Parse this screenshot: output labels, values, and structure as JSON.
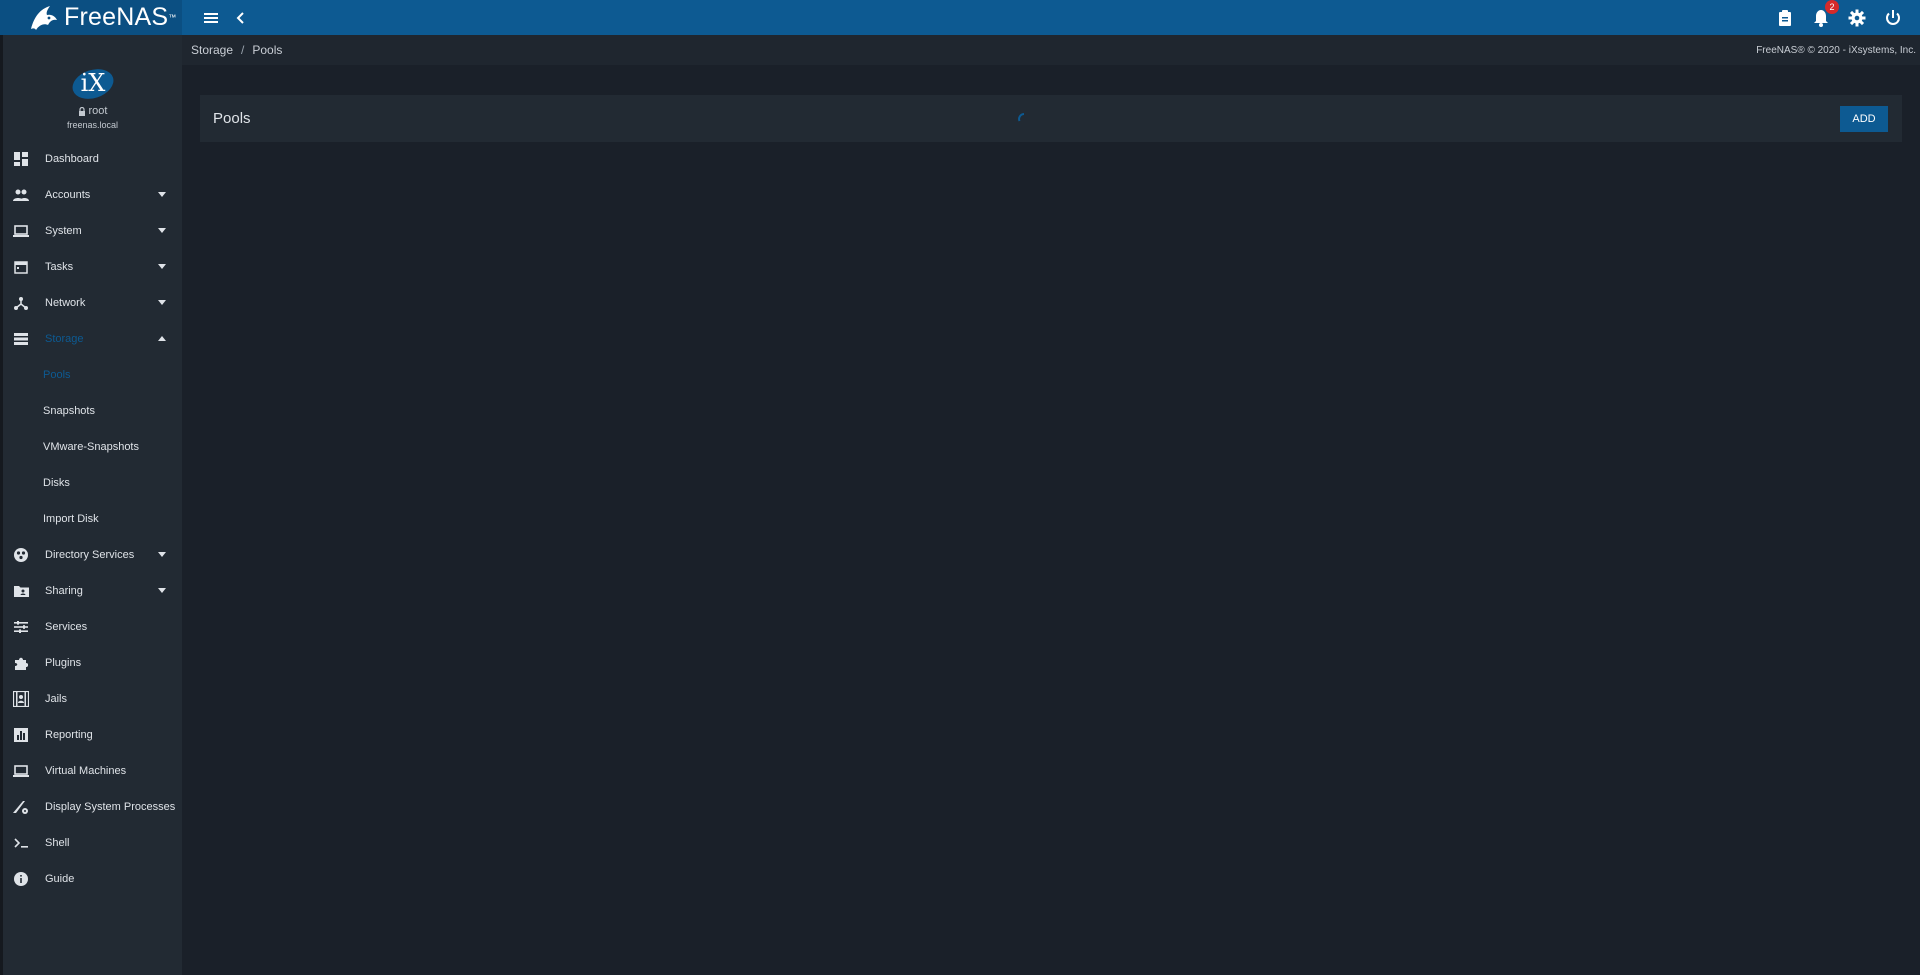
{
  "app": {
    "logo_text": "FreeNAS",
    "logo_tm": "™"
  },
  "topbar": {
    "menu_icon": "menu-icon",
    "back_icon": "chevron-left-icon",
    "notification_count": "2"
  },
  "profile": {
    "avatar_text": "iX",
    "username": "root",
    "hostname": "freenas.local"
  },
  "sidebar": {
    "items": [
      {
        "label": "Dashboard",
        "icon": "dashboard-icon"
      },
      {
        "label": "Accounts",
        "icon": "accounts-icon"
      },
      {
        "label": "System",
        "icon": "system-icon"
      },
      {
        "label": "Tasks",
        "icon": "tasks-icon"
      },
      {
        "label": "Network",
        "icon": "network-icon"
      },
      {
        "label": "Storage",
        "icon": "storage-icon"
      },
      {
        "label": "Directory Services",
        "icon": "directory-services-icon"
      },
      {
        "label": "Sharing",
        "icon": "sharing-icon"
      },
      {
        "label": "Services",
        "icon": "services-icon"
      },
      {
        "label": "Plugins",
        "icon": "plugins-icon"
      },
      {
        "label": "Jails",
        "icon": "jails-icon"
      },
      {
        "label": "Reporting",
        "icon": "reporting-icon"
      },
      {
        "label": "Virtual Machines",
        "icon": "virtual-machines-icon"
      },
      {
        "label": "Display System Processes",
        "icon": "processes-icon"
      },
      {
        "label": "Shell",
        "icon": "shell-icon"
      },
      {
        "label": "Guide",
        "icon": "info-icon"
      }
    ],
    "storage_sub": [
      {
        "label": "Pools"
      },
      {
        "label": "Snapshots"
      },
      {
        "label": "VMware-Snapshots"
      },
      {
        "label": "Disks"
      },
      {
        "label": "Import Disk"
      }
    ]
  },
  "breadcrumb": {
    "items": [
      "Storage",
      "Pools"
    ],
    "separator": "/"
  },
  "copyright": "FreeNAS® © 2020 - iXsystems, Inc.",
  "pools": {
    "title": "Pools",
    "add_label": "ADD"
  },
  "colors": {
    "accent": "#0d5a92",
    "background": "#1a2029",
    "sidebar": "#222a33",
    "badge": "#d42a2a"
  }
}
